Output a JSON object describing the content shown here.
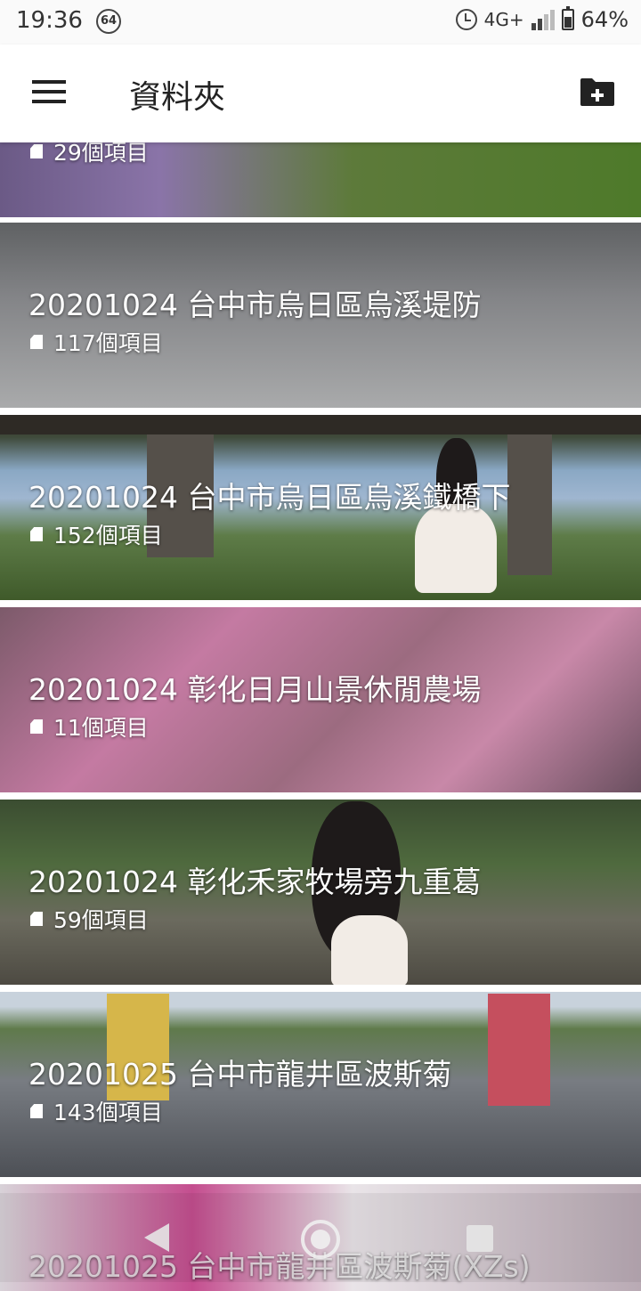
{
  "status_bar": {
    "time": "19:36",
    "notification_badge": "64",
    "network": "4G+",
    "battery": "64%"
  },
  "app_bar": {
    "title": "資料夾",
    "menu_icon": "menu-icon",
    "action_icon": "create-new-folder-icon"
  },
  "folders": [
    {
      "name": "",
      "count": "29個項目"
    },
    {
      "name": "20201024 台中市烏日區烏溪堤防",
      "count": "117個項目"
    },
    {
      "name": "20201024 台中市烏日區烏溪鐵橋下",
      "count": "152個項目"
    },
    {
      "name": "20201024 彰化日月山景休閒農場",
      "count": "11個項目"
    },
    {
      "name": "20201024 彰化禾家牧場旁九重葛",
      "count": "59個項目"
    },
    {
      "name": "20201025 台中市龍井區波斯菊",
      "count": "143個項目"
    },
    {
      "name": "20201025 台中市龍井區波斯菊(XZs)",
      "count": ""
    }
  ],
  "navigation": {
    "back_icon": "back-icon",
    "home_icon": "home-icon",
    "recents_icon": "recents-icon"
  }
}
